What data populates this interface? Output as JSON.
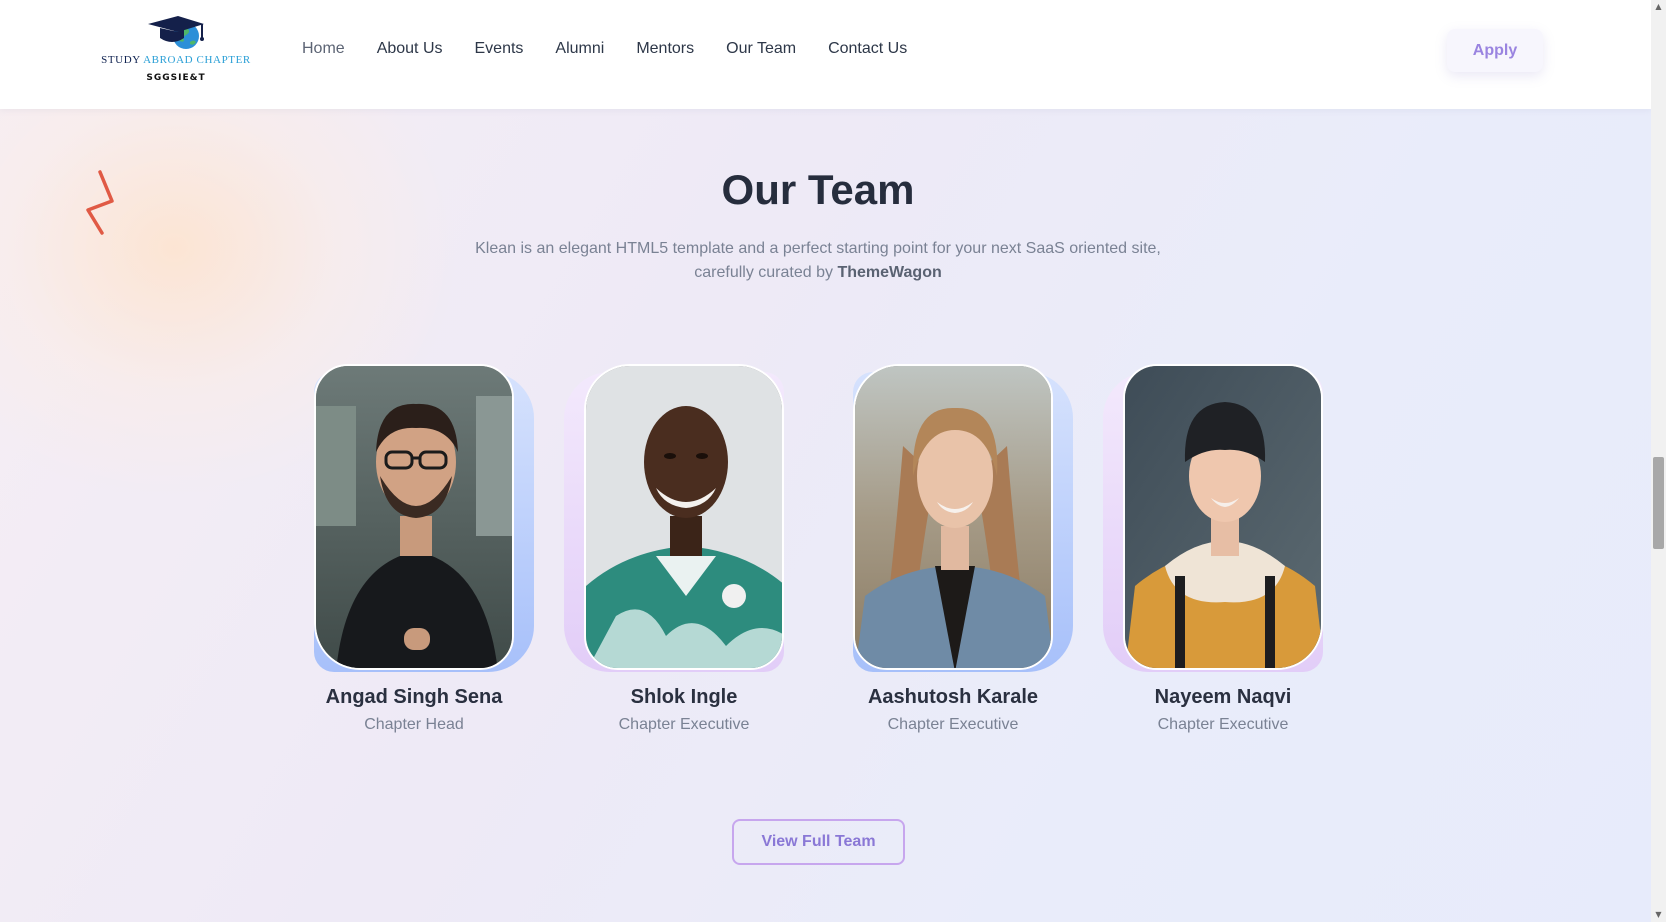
{
  "header": {
    "logo_line1_a": "STUDY ",
    "logo_line1_b": "ABROAD CHAPTER",
    "logo_line2": "SGGSIE&T",
    "nav": [
      {
        "label": "Home"
      },
      {
        "label": "About Us"
      },
      {
        "label": "Events"
      },
      {
        "label": "Alumni"
      },
      {
        "label": "Mentors"
      },
      {
        "label": "Our Team"
      },
      {
        "label": "Contact Us"
      }
    ],
    "apply_label": "Apply"
  },
  "section": {
    "title": "Our Team",
    "subtitle_line1": "Klean is an elegant HTML5 template and a perfect starting point for your next SaaS oriented site,",
    "subtitle_line2": "carefully curated by ",
    "subtitle_brand": "ThemeWagon"
  },
  "team": [
    {
      "name": "Angad Singh Sena",
      "role": "Chapter Head"
    },
    {
      "name": "Shlok Ingle",
      "role": "Chapter Executive"
    },
    {
      "name": "Aashutosh Karale",
      "role": "Chapter Executive"
    },
    {
      "name": "Nayeem Naqvi",
      "role": "Chapter Executive"
    }
  ],
  "view_team_label": "View Full Team",
  "colors": {
    "accent_purple": "#9a84e0",
    "zigzag": "#e05a45",
    "backing_blue": "#a9c3fb",
    "backing_pink": "#e6d2fa"
  },
  "icons": [
    "graduation-cap-globe-icon",
    "zigzag-decoration-icon"
  ]
}
